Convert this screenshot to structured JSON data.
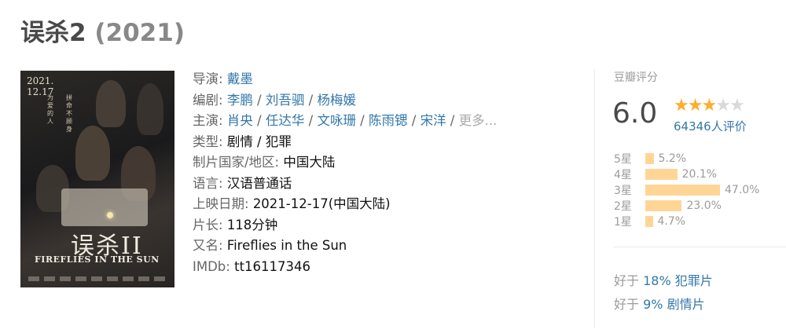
{
  "movie": {
    "title": "误杀2",
    "year": "(2021)"
  },
  "poster": {
    "date": "2021.\n12.17",
    "tagline1": "为爱的人",
    "tagline2": "拼命不顾身",
    "logo_cn": "误杀II",
    "logo_en": "FIREFLIES IN THE SUN"
  },
  "info": {
    "director": {
      "label": "导演:",
      "names": [
        "戴墨"
      ]
    },
    "writers": {
      "label": "编剧:",
      "names": [
        "李鹏",
        "刘吾驷",
        "杨梅媛"
      ]
    },
    "cast": {
      "label": "主演:",
      "names": [
        "肖央",
        "任达华",
        "文咏珊",
        "陈雨锶",
        "宋洋"
      ],
      "more": "更多..."
    },
    "genre": {
      "label": "类型:",
      "value": "剧情 / 犯罪"
    },
    "country": {
      "label": "制片国家/地区:",
      "value": "中国大陆"
    },
    "language": {
      "label": "语言:",
      "value": "汉语普通话"
    },
    "release": {
      "label": "上映日期:",
      "value": "2021-12-17(中国大陆)"
    },
    "runtime": {
      "label": "片长:",
      "value": "118分钟"
    },
    "aka": {
      "label": "又名:",
      "value": "Fireflies in the Sun"
    },
    "imdb": {
      "label": "IMDb:",
      "value": "tt16117346"
    }
  },
  "rating": {
    "title": "豆瓣评分",
    "score": "6.0",
    "stars_filled": 3,
    "stars_total": 5,
    "count_text": "64346人评价",
    "distribution": [
      {
        "label": "5星",
        "percent": 5.2,
        "text": "5.2%"
      },
      {
        "label": "4星",
        "percent": 20.1,
        "text": "20.1%"
      },
      {
        "label": "3星",
        "percent": 47.0,
        "text": "47.0%"
      },
      {
        "label": "2星",
        "percent": 23.0,
        "text": "23.0%"
      },
      {
        "label": "1星",
        "percent": 4.7,
        "text": "4.7%"
      }
    ],
    "better_than": [
      {
        "prefix": "好于",
        "percent": "18%",
        "genre": "犯罪片"
      },
      {
        "prefix": "好于",
        "percent": "9%",
        "genre": "剧情片"
      }
    ]
  },
  "colors": {
    "link": "#3377aa",
    "star": "#ffac2d",
    "bar": "#ffd596"
  }
}
